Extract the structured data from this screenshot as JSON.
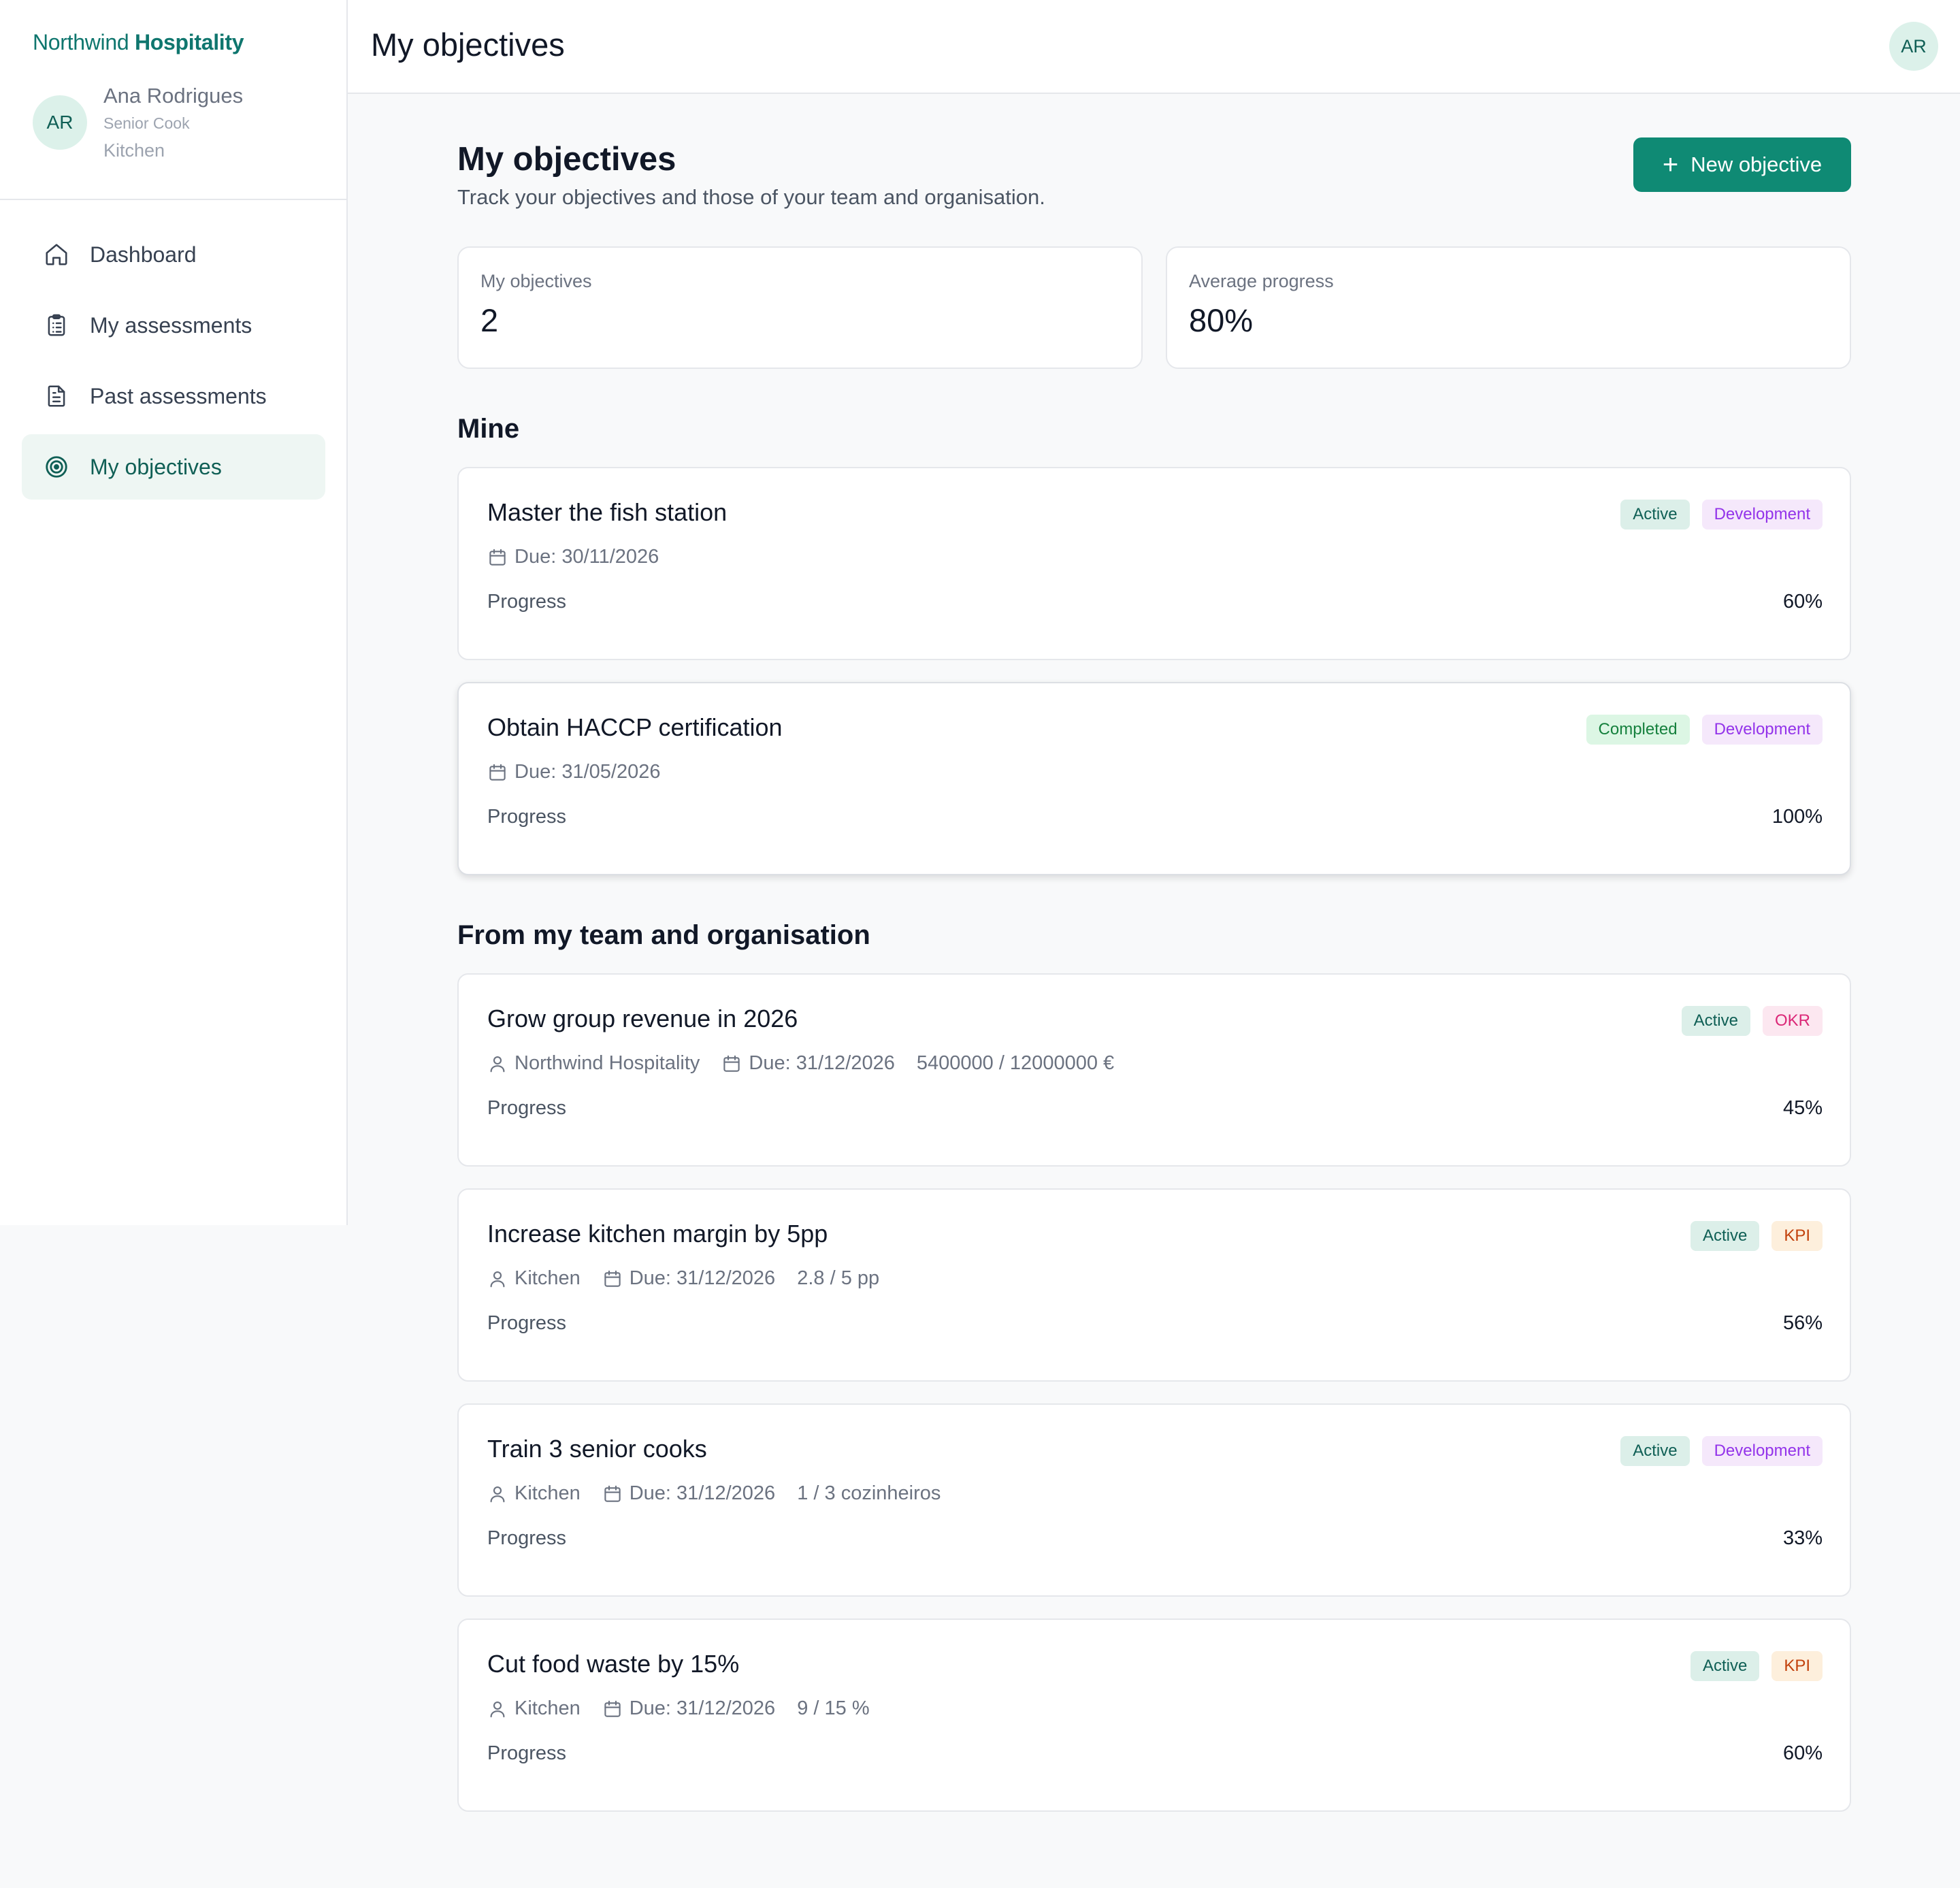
{
  "brand": {
    "part1": "Northwind",
    "part2": "Hospitality"
  },
  "user": {
    "initials": "AR",
    "name": "Ana Rodrigues",
    "role": "Senior Cook",
    "department": "Kitchen"
  },
  "nav": [
    {
      "label": "Dashboard",
      "icon": "home-icon",
      "active": false
    },
    {
      "label": "My assessments",
      "icon": "clipboard-icon",
      "active": false
    },
    {
      "label": "Past assessments",
      "icon": "document-icon",
      "active": false
    },
    {
      "label": "My objectives",
      "icon": "target-icon",
      "active": true
    }
  ],
  "topbar": {
    "title": "My objectives",
    "avatar": "AR"
  },
  "page": {
    "title": "My objectives",
    "subtitle": "Track your objectives and those of your team and organisation.",
    "new_button": "New objective"
  },
  "stats": [
    {
      "label": "My objectives",
      "value": "2"
    },
    {
      "label": "Average progress",
      "value": "80%"
    }
  ],
  "sections": {
    "mine": "Mine",
    "team": "From my team and organisation"
  },
  "progress_label": "Progress",
  "mine": [
    {
      "title": "Master the fish station",
      "status": "Active",
      "type": "Development",
      "due": "Due: 30/11/2026",
      "progress": "60%"
    },
    {
      "title": "Obtain HACCP certification",
      "status": "Completed",
      "type": "Development",
      "due": "Due: 31/05/2026",
      "progress": "100%"
    }
  ],
  "team": [
    {
      "title": "Grow group revenue in 2026",
      "status": "Active",
      "type": "OKR",
      "owner": "Northwind Hospitality",
      "due": "Due: 31/12/2026",
      "target": "5400000 / 12000000 €",
      "progress": "45%"
    },
    {
      "title": "Increase kitchen margin by 5pp",
      "status": "Active",
      "type": "KPI",
      "owner": "Kitchen",
      "due": "Due: 31/12/2026",
      "target": "2.8 / 5 pp",
      "progress": "56%"
    },
    {
      "title": "Train 3 senior cooks",
      "status": "Active",
      "type": "Development",
      "owner": "Kitchen",
      "due": "Due: 31/12/2026",
      "target": "1 / 3 cozinheiros",
      "progress": "33%"
    },
    {
      "title": "Cut food waste by 15%",
      "status": "Active",
      "type": "KPI",
      "owner": "Kitchen",
      "due": "Due: 31/12/2026",
      "target": "9 / 15 %",
      "progress": "60%"
    }
  ],
  "colors": {
    "accent": "#0f8a74",
    "brand": "#0f766e",
    "active_nav_bg": "#eef6f3"
  }
}
